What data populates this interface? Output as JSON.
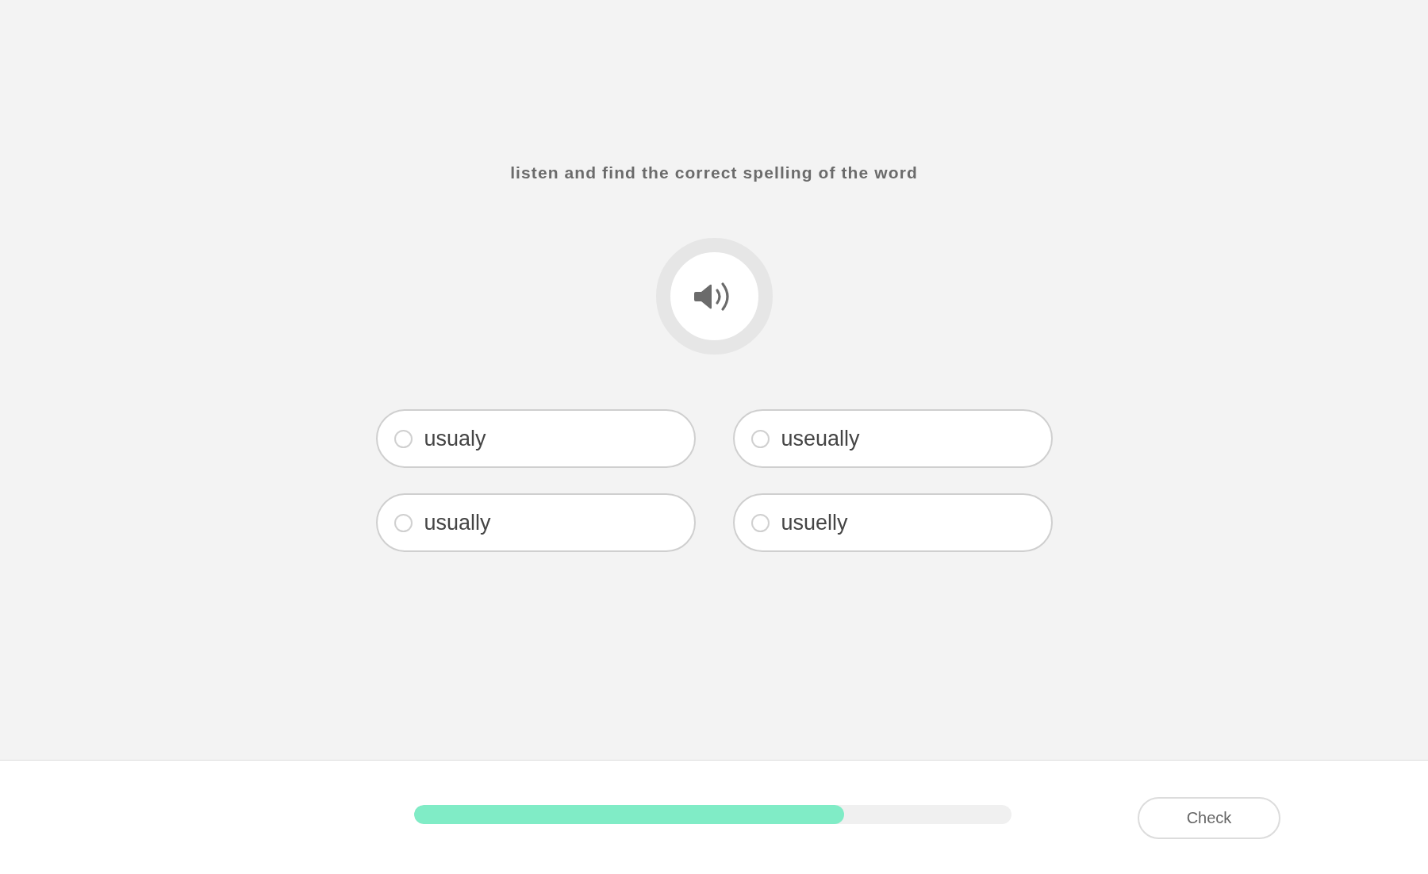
{
  "instruction": "listen and find the correct spelling of the word",
  "options": [
    {
      "label": "usualy",
      "selected": false
    },
    {
      "label": "useually",
      "selected": false
    },
    {
      "label": "usually",
      "selected": false
    },
    {
      "label": "usuelly",
      "selected": false
    }
  ],
  "progress": {
    "level": 0.72
  },
  "check_button": {
    "label": "Check"
  }
}
